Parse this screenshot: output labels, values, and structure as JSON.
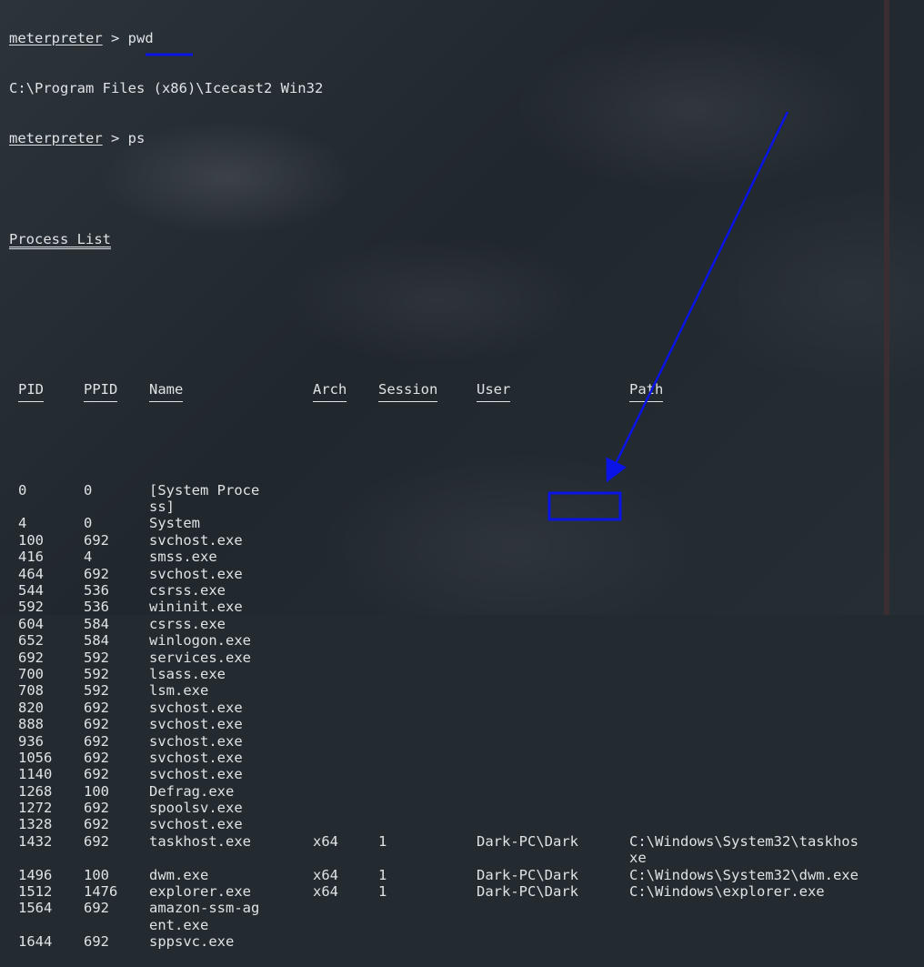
{
  "terminal": {
    "prompt": "meterpreter",
    "prompt_sep": " > ",
    "cmd1": "pwd",
    "cwd": "C:\\Program Files (x86)\\Icecast2 Win32",
    "cmd2": "ps",
    "title": "Process List"
  },
  "columns": [
    "PID",
    "PPID",
    "Name",
    "Arch",
    "Session",
    "User",
    "Path"
  ],
  "processes": [
    {
      "pid": "0",
      "ppid": "0",
      "name": [
        "[System Proce",
        "ss]"
      ],
      "arch": "",
      "session": "",
      "user": "",
      "path": []
    },
    {
      "pid": "4",
      "ppid": "0",
      "name": [
        "System"
      ],
      "arch": "",
      "session": "",
      "user": "",
      "path": []
    },
    {
      "pid": "100",
      "ppid": "692",
      "name": [
        "svchost.exe"
      ],
      "arch": "",
      "session": "",
      "user": "",
      "path": []
    },
    {
      "pid": "416",
      "ppid": "4",
      "name": [
        "smss.exe"
      ],
      "arch": "",
      "session": "",
      "user": "",
      "path": []
    },
    {
      "pid": "464",
      "ppid": "692",
      "name": [
        "svchost.exe"
      ],
      "arch": "",
      "session": "",
      "user": "",
      "path": []
    },
    {
      "pid": "544",
      "ppid": "536",
      "name": [
        "csrss.exe"
      ],
      "arch": "",
      "session": "",
      "user": "",
      "path": []
    },
    {
      "pid": "592",
      "ppid": "536",
      "name": [
        "wininit.exe"
      ],
      "arch": "",
      "session": "",
      "user": "",
      "path": []
    },
    {
      "pid": "604",
      "ppid": "584",
      "name": [
        "csrss.exe"
      ],
      "arch": "",
      "session": "",
      "user": "",
      "path": []
    },
    {
      "pid": "652",
      "ppid": "584",
      "name": [
        "winlogon.exe"
      ],
      "arch": "",
      "session": "",
      "user": "",
      "path": []
    },
    {
      "pid": "692",
      "ppid": "592",
      "name": [
        "services.exe"
      ],
      "arch": "",
      "session": "",
      "user": "",
      "path": []
    },
    {
      "pid": "700",
      "ppid": "592",
      "name": [
        "lsass.exe"
      ],
      "arch": "",
      "session": "",
      "user": "",
      "path": []
    },
    {
      "pid": "708",
      "ppid": "592",
      "name": [
        "lsm.exe"
      ],
      "arch": "",
      "session": "",
      "user": "",
      "path": []
    },
    {
      "pid": "820",
      "ppid": "692",
      "name": [
        "svchost.exe"
      ],
      "arch": "",
      "session": "",
      "user": "",
      "path": []
    },
    {
      "pid": "888",
      "ppid": "692",
      "name": [
        "svchost.exe"
      ],
      "arch": "",
      "session": "",
      "user": "",
      "path": []
    },
    {
      "pid": "936",
      "ppid": "692",
      "name": [
        "svchost.exe"
      ],
      "arch": "",
      "session": "",
      "user": "",
      "path": []
    },
    {
      "pid": "1056",
      "ppid": "692",
      "name": [
        "svchost.exe"
      ],
      "arch": "",
      "session": "",
      "user": "",
      "path": []
    },
    {
      "pid": "1140",
      "ppid": "692",
      "name": [
        "svchost.exe"
      ],
      "arch": "",
      "session": "",
      "user": "",
      "path": []
    },
    {
      "pid": "1268",
      "ppid": "100",
      "name": [
        "Defrag.exe"
      ],
      "arch": "",
      "session": "",
      "user": "",
      "path": []
    },
    {
      "pid": "1272",
      "ppid": "692",
      "name": [
        "spoolsv.exe"
      ],
      "arch": "",
      "session": "",
      "user": "",
      "path": []
    },
    {
      "pid": "1328",
      "ppid": "692",
      "name": [
        "svchost.exe"
      ],
      "arch": "",
      "session": "",
      "user": "",
      "path": []
    },
    {
      "pid": "1432",
      "ppid": "692",
      "name": [
        "taskhost.exe"
      ],
      "arch": "x64",
      "session": "1",
      "user": "Dark-PC\\Dark",
      "path": [
        "C:\\Windows\\System32\\taskhos",
        "xe"
      ]
    },
    {
      "pid": "1496",
      "ppid": "100",
      "name": [
        "dwm.exe"
      ],
      "arch": "x64",
      "session": "1",
      "user": "Dark-PC\\Dark",
      "path": [
        "C:\\Windows\\System32\\dwm.exe"
      ]
    },
    {
      "pid": "1512",
      "ppid": "1476",
      "name": [
        "explorer.exe"
      ],
      "arch": "x64",
      "session": "1",
      "user": "Dark-PC\\Dark",
      "path": [
        "C:\\Windows\\explorer.exe"
      ]
    },
    {
      "pid": "1564",
      "ppid": "692",
      "name": [
        "amazon-ssm-ag",
        "ent.exe"
      ],
      "arch": "",
      "session": "",
      "user": "",
      "path": []
    },
    {
      "pid": "1644",
      "ppid": "692",
      "name": [
        "sppsvc.exe"
      ],
      "arch": "",
      "session": "",
      "user": "",
      "path": []
    }
  ],
  "annotations": {
    "color": "#0a14e6"
  }
}
